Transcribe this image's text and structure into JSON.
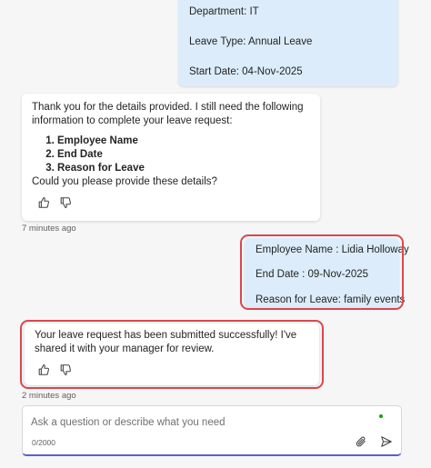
{
  "user_message_1": {
    "lines": [
      "Department: IT",
      "Leave Type: Annual Leave",
      "Start Date: 04-Nov-2025"
    ]
  },
  "bot_message_1": {
    "intro": "Thank you for the details provided. I still need the following information to complete your leave request:",
    "items": [
      "Employee Name",
      "End Date",
      "Reason for Leave"
    ],
    "outro": "Could you please provide these details?",
    "timestamp": "7 minutes ago"
  },
  "user_message_2": {
    "lines": [
      "Employee Name : Lidia Holloway",
      "End Date : 09-Nov-2025",
      "Reason for Leave: family events"
    ]
  },
  "bot_message_2": {
    "text": "Your leave request has been submitted successfully! I've shared it with your manager for review.",
    "timestamp": "2 minutes ago"
  },
  "composer": {
    "placeholder": "Ask a question or describe what you need",
    "counter": "0/2000"
  },
  "icons": {
    "like": "thumbs-up-icon",
    "dislike": "thumbs-down-icon",
    "attach": "paperclip-icon",
    "send": "send-icon"
  },
  "colors": {
    "user_bubble": "#dcecfa",
    "highlight": "#d9474f",
    "accent": "#5b5fc7",
    "status_dot": "#13a10e"
  }
}
